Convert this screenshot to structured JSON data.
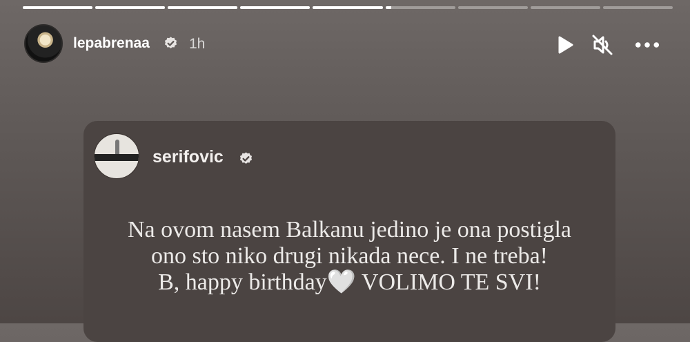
{
  "story": {
    "progress": [
      1,
      1,
      1,
      1,
      1,
      0.08,
      0,
      0,
      0
    ]
  },
  "header": {
    "username": "lepabrenaa",
    "time": "1h",
    "icons": {
      "verified": "verified-badge-icon",
      "play": "play-icon",
      "mute": "muted-speaker-icon",
      "more": "more-options-icon"
    }
  },
  "card": {
    "username": "serifovic",
    "text_lines": [
      "Na ovom nasem Balkanu jedino je ona postigla",
      "ono sto niko drugi nikada nece. I ne treba!",
      "B, happy birthday🤍 VOLIMO TE SVI!"
    ]
  },
  "colors": {
    "background": "#5e5856",
    "card": "#4b4442",
    "text": "#eceae8"
  }
}
